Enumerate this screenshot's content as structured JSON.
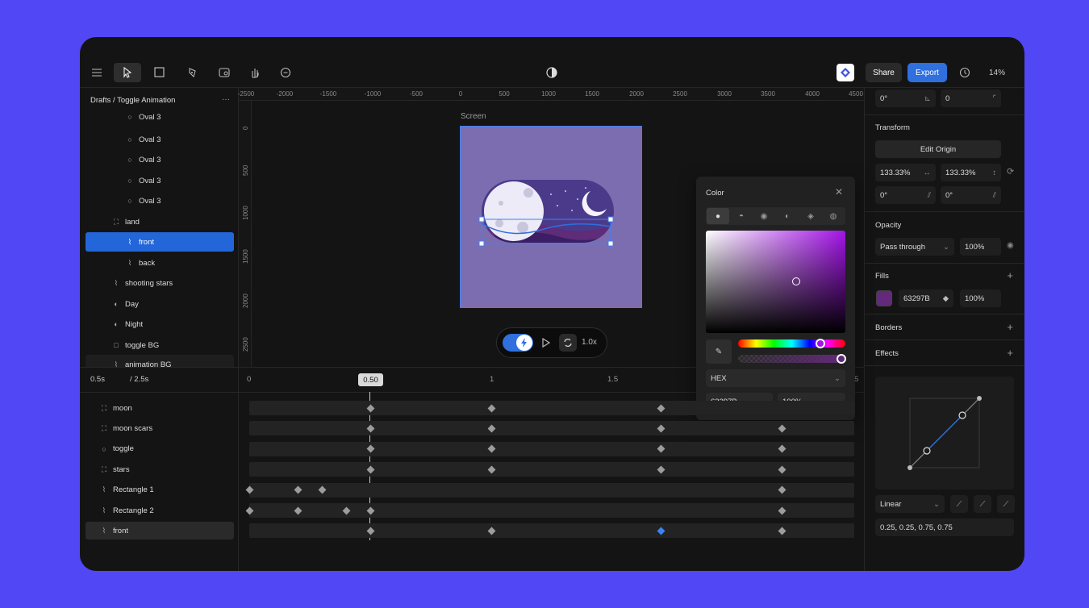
{
  "toolbar": {
    "zoom": "14%",
    "share_label": "Share",
    "export_label": "Export"
  },
  "breadcrumb": "Drafts / Toggle Animation",
  "more": "···",
  "layers": [
    {
      "label": "Oval 3",
      "icon": "oval"
    },
    {
      "label": "Oval 3",
      "icon": "oval"
    },
    {
      "label": "Oval 3",
      "icon": "oval"
    },
    {
      "label": "Oval 3",
      "icon": "oval"
    },
    {
      "label": "Oval 3",
      "icon": "oval"
    },
    {
      "label": "land",
      "icon": "frame"
    },
    {
      "label": "front",
      "icon": "path",
      "selected": true
    },
    {
      "label": "back",
      "icon": "path"
    },
    {
      "label": "shooting stars",
      "icon": "path"
    },
    {
      "label": "Day",
      "icon": "half"
    },
    {
      "label": "Night",
      "icon": "half"
    },
    {
      "label": "toggle BG",
      "icon": "rect"
    },
    {
      "label": "animation BG",
      "icon": "path"
    }
  ],
  "ruler_h": [
    "-2500",
    "-2000",
    "-1500",
    "-1000",
    "-500",
    "0",
    "500",
    "1000",
    "1500",
    "2000",
    "2500",
    "3000",
    "3500",
    "4000",
    "4500"
  ],
  "ruler_v": [
    "0",
    "500",
    "1000",
    "1500",
    "2000",
    "2500"
  ],
  "canvas": {
    "frame_label": "Screen",
    "speed": "1.0x"
  },
  "timeline": {
    "current_time": "0.5s",
    "total": "/ 2.5s",
    "playhead": "0.50",
    "ticks": [
      "0",
      "1",
      "1.5",
      "5"
    ],
    "rows": [
      {
        "label": "moon",
        "icon": "frame",
        "keys": [
          0.5,
          1.0,
          1.7
        ]
      },
      {
        "label": "moon scars",
        "icon": "frame",
        "keys": [
          0.5,
          1.0,
          1.7,
          2.2
        ]
      },
      {
        "label": "toggle",
        "icon": "oval",
        "keys": [
          0.5,
          1.0,
          1.7,
          2.2
        ]
      },
      {
        "label": "stars",
        "icon": "frame",
        "keys": [
          0.5,
          1.0,
          1.7,
          2.2
        ]
      },
      {
        "label": "Rectangle 1",
        "icon": "path",
        "keys": [
          0.0,
          0.2,
          0.3,
          2.2
        ]
      },
      {
        "label": "Rectangle 2",
        "icon": "path",
        "keys": [
          0.0,
          0.2,
          0.4,
          0.5,
          2.2
        ]
      },
      {
        "label": "front",
        "icon": "path",
        "keys": [
          0.5,
          1.0,
          1.7,
          2.2
        ],
        "selected_key": 1.7
      }
    ]
  },
  "color_picker": {
    "title": "Color",
    "mode": "HEX",
    "hex": "63297B",
    "opacity": "100%"
  },
  "right": {
    "rot1": "0°",
    "rot2": "0",
    "transform_title": "Transform",
    "edit_origin": "Edit Origin",
    "scale_x": "133.33%",
    "scale_y": "133.33%",
    "skew_x": "0°",
    "skew_y": "0°",
    "opacity_title": "Opacity",
    "blend": "Pass through",
    "opacity": "100%",
    "fills_title": "Fills",
    "fill_hex": "63297B",
    "fill_opacity": "100%",
    "borders_title": "Borders",
    "effects_title": "Effects",
    "easing": "Linear",
    "bezier": "0.25, 0.25, 0.75, 0.75"
  },
  "colors": {
    "fill": "#63297b",
    "accent": "#2f6fde",
    "frame_bg": "#7b6db0"
  }
}
